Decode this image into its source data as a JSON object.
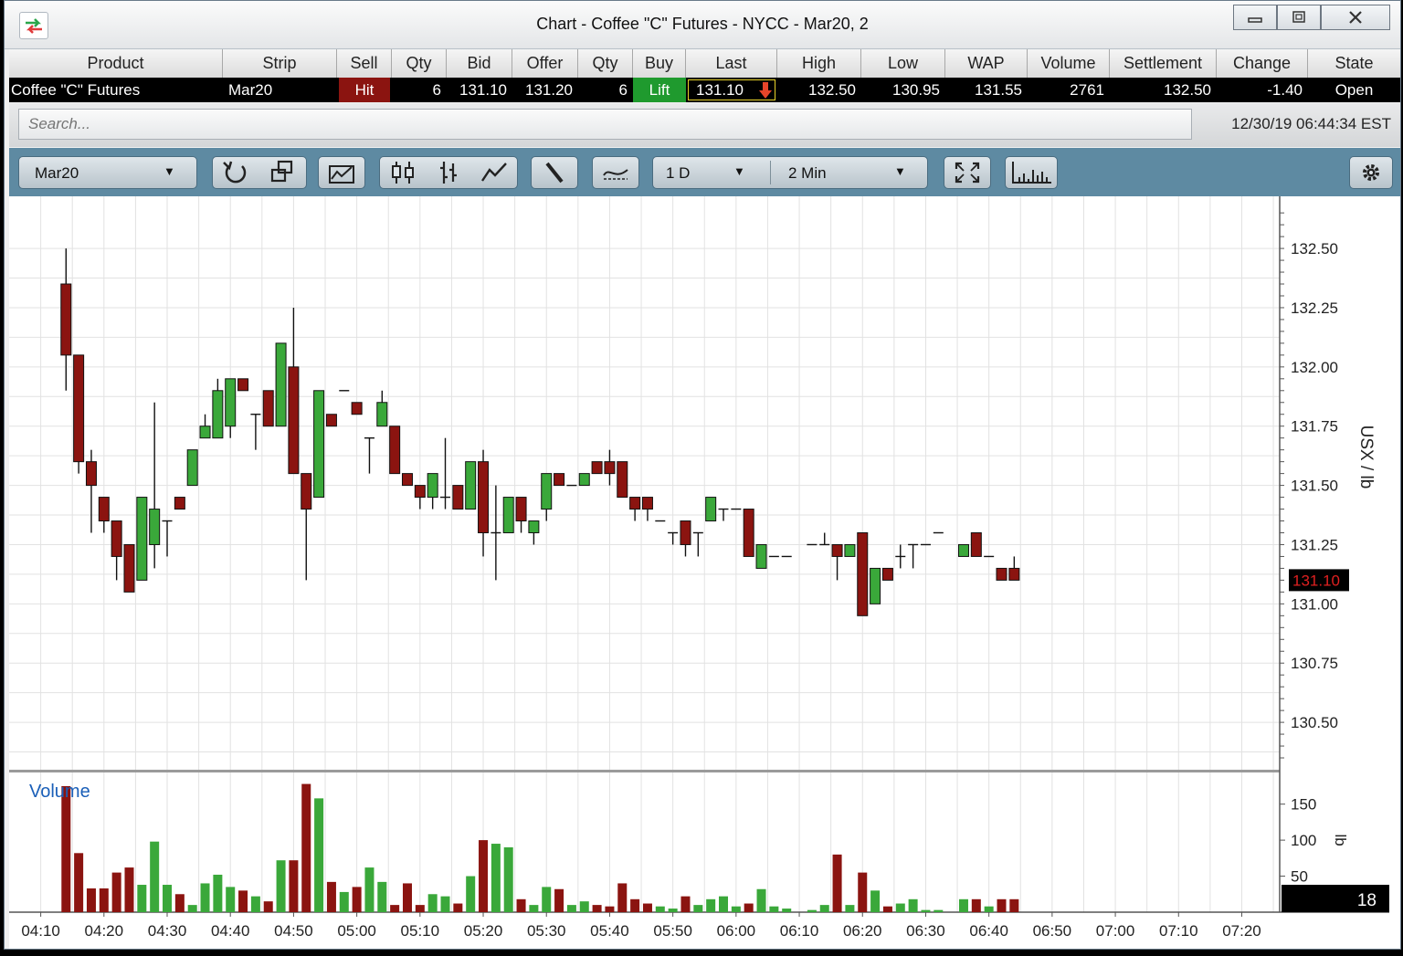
{
  "window": {
    "title": "Chart - Coffee \"C\" Futures - NYCC - Mar20, 2"
  },
  "quote": {
    "headers": [
      "Product",
      "Strip",
      "Sell",
      "Qty",
      "Bid",
      "Offer",
      "Qty",
      "Buy",
      "Last",
      "High",
      "Low",
      "WAP",
      "Volume",
      "Settlement",
      "Change",
      "State"
    ],
    "row": {
      "product": "Coffee \"C\" Futures",
      "strip": "Mar20",
      "sell": "Hit",
      "bid_qty": "6",
      "bid": "131.10",
      "offer": "131.20",
      "offer_qty": "6",
      "buy": "Lift",
      "last": "131.10",
      "high": "132.50",
      "low": "130.95",
      "wap": "131.55",
      "volume": "2761",
      "settlement": "132.50",
      "change": "-1.40",
      "state": "Open"
    }
  },
  "search": {
    "placeholder": "Search...",
    "timestamp": "12/30/19 06:44:34 EST"
  },
  "toolbar": {
    "strip_select": "Mar20",
    "period_select": "1 D",
    "interval_select": "2 Min"
  },
  "colors": {
    "up": "#3aa83a",
    "down": "#8b1410",
    "toolbar": "#5e8aa2",
    "grid": "#e2e2e2",
    "last_tag": "#000000",
    "last_tag_text": "#e02020"
  },
  "chart_data": {
    "type": "candlestick",
    "price_axis_label": "USX / lb",
    "volume_label": "Volume",
    "volume_axis_label": "lb",
    "last_price_label": "131.10",
    "last_volume_label": "18",
    "y_ticks": [
      "132.50",
      "132.25",
      "132.00",
      "131.75",
      "131.50",
      "131.25",
      "131.00",
      "130.75",
      "130.50"
    ],
    "y_range": [
      130.3,
      132.72
    ],
    "volume_ticks": [
      "150",
      "100",
      "50"
    ],
    "volume_range": [
      0,
      180
    ],
    "x_ticks": [
      "04:10",
      "04:20",
      "04:30",
      "04:40",
      "04:50",
      "05:00",
      "05:10",
      "05:20",
      "05:30",
      "05:40",
      "05:50",
      "06:00",
      "06:10",
      "06:20",
      "06:30",
      "06:40",
      "06:50",
      "07:00",
      "07:10",
      "07:20"
    ],
    "x_range_minutes": [
      245,
      446
    ],
    "bars": [
      {
        "t": 254,
        "o": 132.35,
        "h": 132.5,
        "l": 131.9,
        "c": 132.05,
        "v": 175
      },
      {
        "t": 256,
        "o": 132.05,
        "h": 132.05,
        "l": 131.55,
        "c": 131.6,
        "v": 82
      },
      {
        "t": 258,
        "o": 131.6,
        "h": 131.65,
        "l": 131.3,
        "c": 131.5,
        "v": 33
      },
      {
        "t": 260,
        "o": 131.45,
        "h": 131.45,
        "l": 131.3,
        "c": 131.35,
        "v": 33
      },
      {
        "t": 262,
        "o": 131.35,
        "h": 131.35,
        "l": 131.1,
        "c": 131.2,
        "v": 55
      },
      {
        "t": 264,
        "o": 131.25,
        "h": 131.25,
        "l": 131.05,
        "c": 131.05,
        "v": 62
      },
      {
        "t": 266,
        "o": 131.1,
        "h": 131.45,
        "l": 131.1,
        "c": 131.45,
        "v": 38
      },
      {
        "t": 268,
        "o": 131.25,
        "h": 131.85,
        "l": 131.15,
        "c": 131.4,
        "v": 98
      },
      {
        "t": 270,
        "o": 131.35,
        "h": 131.35,
        "l": 131.2,
        "c": 131.35,
        "v": 38
      },
      {
        "t": 272,
        "o": 131.45,
        "h": 131.45,
        "l": 131.4,
        "c": 131.4,
        "v": 25
      },
      {
        "t": 274,
        "o": 131.5,
        "h": 131.65,
        "l": 131.5,
        "c": 131.65,
        "v": 10
      },
      {
        "t": 276,
        "o": 131.7,
        "h": 131.8,
        "l": 131.7,
        "c": 131.75,
        "v": 40
      },
      {
        "t": 278,
        "o": 131.7,
        "h": 131.95,
        "l": 131.7,
        "c": 131.9,
        "v": 52
      },
      {
        "t": 280,
        "o": 131.75,
        "h": 131.95,
        "l": 131.7,
        "c": 131.95,
        "v": 35
      },
      {
        "t": 282,
        "o": 131.95,
        "h": 131.95,
        "l": 131.9,
        "c": 131.9,
        "v": 30
      },
      {
        "t": 284,
        "o": 131.8,
        "h": 131.8,
        "l": 131.65,
        "c": 131.8,
        "v": 22
      },
      {
        "t": 286,
        "o": 131.9,
        "h": 131.9,
        "l": 131.75,
        "c": 131.75,
        "v": 15
      },
      {
        "t": 288,
        "o": 131.75,
        "h": 132.1,
        "l": 131.75,
        "c": 132.1,
        "v": 72
      },
      {
        "t": 290,
        "o": 132.0,
        "h": 132.25,
        "l": 131.55,
        "c": 131.55,
        "v": 72
      },
      {
        "t": 292,
        "o": 131.55,
        "h": 131.55,
        "l": 131.1,
        "c": 131.4,
        "v": 178
      },
      {
        "t": 294,
        "o": 131.45,
        "h": 131.9,
        "l": 131.45,
        "c": 131.9,
        "v": 158
      },
      {
        "t": 296,
        "o": 131.8,
        "h": 131.8,
        "l": 131.75,
        "c": 131.75,
        "v": 42
      },
      {
        "t": 298,
        "o": 131.9,
        "h": 131.9,
        "l": 131.9,
        "c": 131.9,
        "v": 28
      },
      {
        "t": 300,
        "o": 131.85,
        "h": 131.85,
        "l": 131.8,
        "c": 131.8,
        "v": 35
      },
      {
        "t": 302,
        "o": 131.7,
        "h": 131.7,
        "l": 131.55,
        "c": 131.7,
        "v": 62
      },
      {
        "t": 304,
        "o": 131.75,
        "h": 131.9,
        "l": 131.75,
        "c": 131.85,
        "v": 42
      },
      {
        "t": 306,
        "o": 131.75,
        "h": 131.75,
        "l": 131.55,
        "c": 131.55,
        "v": 10
      },
      {
        "t": 308,
        "o": 131.55,
        "h": 131.55,
        "l": 131.5,
        "c": 131.5,
        "v": 40
      },
      {
        "t": 310,
        "o": 131.5,
        "h": 131.5,
        "l": 131.4,
        "c": 131.45,
        "v": 10
      },
      {
        "t": 312,
        "o": 131.45,
        "h": 131.55,
        "l": 131.4,
        "c": 131.55,
        "v": 25
      },
      {
        "t": 314,
        "o": 131.45,
        "h": 131.7,
        "l": 131.4,
        "c": 131.45,
        "v": 22
      },
      {
        "t": 316,
        "o": 131.5,
        "h": 131.5,
        "l": 131.4,
        "c": 131.4,
        "v": 12
      },
      {
        "t": 318,
        "o": 131.4,
        "h": 131.6,
        "l": 131.4,
        "c": 131.6,
        "v": 50
      },
      {
        "t": 320,
        "o": 131.6,
        "h": 131.65,
        "l": 131.2,
        "c": 131.3,
        "v": 100
      },
      {
        "t": 322,
        "o": 131.3,
        "h": 131.5,
        "l": 131.1,
        "c": 131.3,
        "v": 95
      },
      {
        "t": 324,
        "o": 131.3,
        "h": 131.45,
        "l": 131.3,
        "c": 131.45,
        "v": 90
      },
      {
        "t": 326,
        "o": 131.45,
        "h": 131.45,
        "l": 131.3,
        "c": 131.35,
        "v": 18
      },
      {
        "t": 328,
        "o": 131.3,
        "h": 131.35,
        "l": 131.25,
        "c": 131.35,
        "v": 10
      },
      {
        "t": 330,
        "o": 131.4,
        "h": 131.55,
        "l": 131.35,
        "c": 131.55,
        "v": 35
      },
      {
        "t": 332,
        "o": 131.55,
        "h": 131.55,
        "l": 131.5,
        "c": 131.5,
        "v": 32
      },
      {
        "t": 334,
        "o": 131.5,
        "h": 131.5,
        "l": 131.5,
        "c": 131.5,
        "v": 10
      },
      {
        "t": 336,
        "o": 131.5,
        "h": 131.55,
        "l": 131.5,
        "c": 131.55,
        "v": 15
      },
      {
        "t": 338,
        "o": 131.6,
        "h": 131.6,
        "l": 131.55,
        "c": 131.55,
        "v": 10
      },
      {
        "t": 340,
        "o": 131.6,
        "h": 131.65,
        "l": 131.5,
        "c": 131.55,
        "v": 8
      },
      {
        "t": 342,
        "o": 131.6,
        "h": 131.6,
        "l": 131.45,
        "c": 131.45,
        "v": 40
      },
      {
        "t": 344,
        "o": 131.45,
        "h": 131.45,
        "l": 131.35,
        "c": 131.4,
        "v": 18
      },
      {
        "t": 346,
        "o": 131.45,
        "h": 131.45,
        "l": 131.35,
        "c": 131.4,
        "v": 12
      },
      {
        "t": 348,
        "o": 131.35,
        "h": 131.35,
        "l": 131.35,
        "c": 131.35,
        "v": 8
      },
      {
        "t": 350,
        "o": 131.3,
        "h": 131.3,
        "l": 131.25,
        "c": 131.3,
        "v": 5
      },
      {
        "t": 352,
        "o": 131.35,
        "h": 131.35,
        "l": 131.2,
        "c": 131.25,
        "v": 22
      },
      {
        "t": 354,
        "o": 131.3,
        "h": 131.3,
        "l": 131.2,
        "c": 131.3,
        "v": 10
      },
      {
        "t": 356,
        "o": 131.35,
        "h": 131.45,
        "l": 131.35,
        "c": 131.45,
        "v": 18
      },
      {
        "t": 358,
        "o": 131.4,
        "h": 131.4,
        "l": 131.35,
        "c": 131.4,
        "v": 22
      },
      {
        "t": 360,
        "o": 131.4,
        "h": 131.4,
        "l": 131.4,
        "c": 131.4,
        "v": 8
      },
      {
        "t": 362,
        "o": 131.4,
        "h": 131.4,
        "l": 131.2,
        "c": 131.2,
        "v": 12
      },
      {
        "t": 364,
        "o": 131.15,
        "h": 131.25,
        "l": 131.15,
        "c": 131.25,
        "v": 32
      },
      {
        "t": 366,
        "o": 131.2,
        "h": 131.2,
        "l": 131.2,
        "c": 131.2,
        "v": 8
      },
      {
        "t": 368,
        "o": 131.2,
        "h": 131.2,
        "l": 131.2,
        "c": 131.2,
        "v": 5
      },
      {
        "t": 372,
        "o": 131.25,
        "h": 131.25,
        "l": 131.25,
        "c": 131.25,
        "v": 3
      },
      {
        "t": 374,
        "o": 131.25,
        "h": 131.3,
        "l": 131.25,
        "c": 131.25,
        "v": 10
      },
      {
        "t": 376,
        "o": 131.25,
        "h": 131.25,
        "l": 131.1,
        "c": 131.2,
        "v": 80
      },
      {
        "t": 378,
        "o": 131.2,
        "h": 131.25,
        "l": 131.2,
        "c": 131.25,
        "v": 10
      },
      {
        "t": 380,
        "o": 131.3,
        "h": 131.3,
        "l": 130.95,
        "c": 130.95,
        "v": 55
      },
      {
        "t": 382,
        "o": 131.0,
        "h": 131.15,
        "l": 131.0,
        "c": 131.15,
        "v": 30
      },
      {
        "t": 384,
        "o": 131.15,
        "h": 131.15,
        "l": 131.1,
        "c": 131.1,
        "v": 8
      },
      {
        "t": 386,
        "o": 131.2,
        "h": 131.25,
        "l": 131.15,
        "c": 131.2,
        "v": 12
      },
      {
        "t": 388,
        "o": 131.25,
        "h": 131.25,
        "l": 131.15,
        "c": 131.25,
        "v": 18
      },
      {
        "t": 390,
        "o": 131.25,
        "h": 131.25,
        "l": 131.25,
        "c": 131.25,
        "v": 3
      },
      {
        "t": 392,
        "o": 131.3,
        "h": 131.3,
        "l": 131.3,
        "c": 131.3,
        "v": 3
      },
      {
        "t": 396,
        "o": 131.2,
        "h": 131.25,
        "l": 131.2,
        "c": 131.25,
        "v": 18
      },
      {
        "t": 398,
        "o": 131.3,
        "h": 131.3,
        "l": 131.2,
        "c": 131.2,
        "v": 18
      },
      {
        "t": 400,
        "o": 131.2,
        "h": 131.2,
        "l": 131.2,
        "c": 131.2,
        "v": 8
      },
      {
        "t": 402,
        "o": 131.15,
        "h": 131.15,
        "l": 131.1,
        "c": 131.1,
        "v": 18
      },
      {
        "t": 404,
        "o": 131.15,
        "h": 131.2,
        "l": 131.1,
        "c": 131.1,
        "v": 18
      }
    ]
  }
}
